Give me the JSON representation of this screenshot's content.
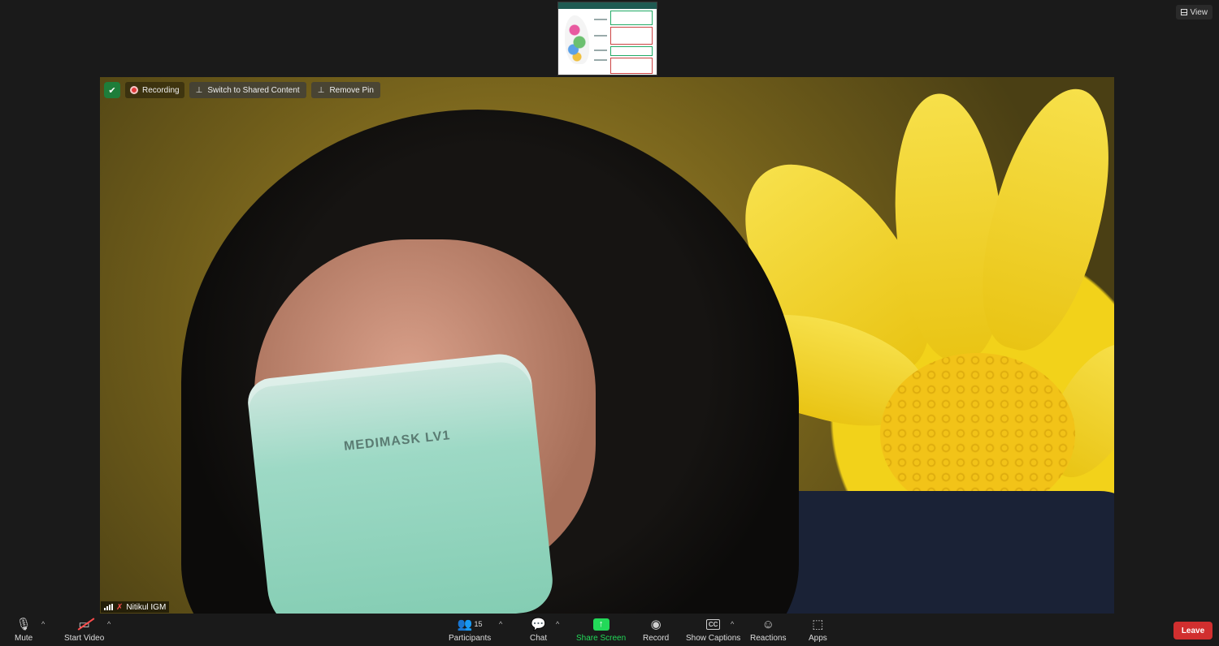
{
  "view_button": {
    "label": "View",
    "icon": "view-grid-icon"
  },
  "overlay": {
    "security_icon": "shield-check-icon",
    "recording_label": "Recording",
    "switch_shared_label": "Switch to Shared Content",
    "remove_pin_label": "Remove Pin"
  },
  "video": {
    "participant_name": "Nitikul IGM",
    "mask_text": "MEDIMASK LV1",
    "mic_status": "muted"
  },
  "toolbar": {
    "mute": "Mute",
    "start_video": "Start Video",
    "participants": "Participants",
    "participants_count": "15",
    "chat": "Chat",
    "share_screen": "Share Screen",
    "record": "Record",
    "show_captions": "Show Captions",
    "reactions": "Reactions",
    "apps": "Apps",
    "leave": "Leave"
  },
  "colors": {
    "share_accent": "#23d959",
    "leave_red": "#d12f2f",
    "security_green": "#1e7d3a"
  }
}
